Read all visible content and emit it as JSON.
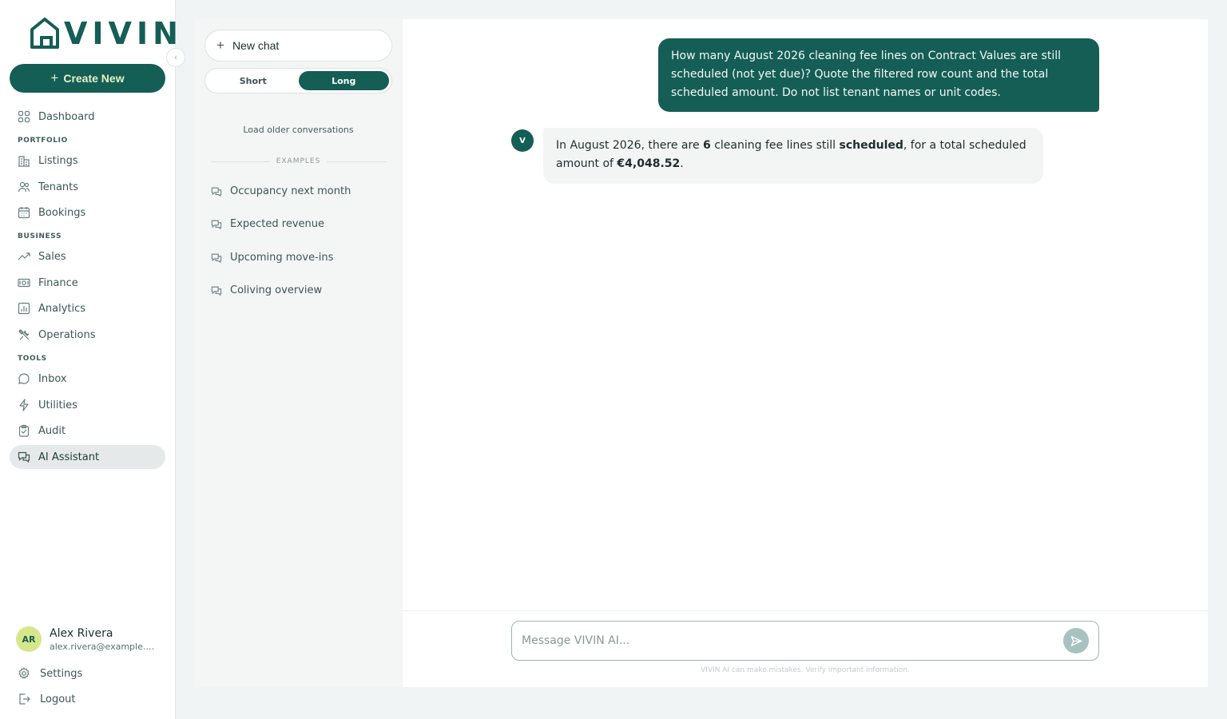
{
  "brand": {
    "name": "VIVIN"
  },
  "sidebar": {
    "create_label": "Create New",
    "dashboard": "Dashboard",
    "sections": {
      "portfolio": "PORTFOLIO",
      "business": "BUSINESS",
      "tools": "TOOLS"
    },
    "portfolio": [
      "Listings",
      "Tenants",
      "Bookings"
    ],
    "business": [
      "Sales",
      "Finance",
      "Analytics",
      "Operations"
    ],
    "tools": [
      "Inbox",
      "Utilities",
      "Audit",
      "AI Assistant"
    ],
    "active_item": "AI Assistant"
  },
  "user": {
    "initials": "AR",
    "name": "Alex Rivera",
    "email": "alex.rivera@example.com"
  },
  "footer": {
    "settings": "Settings",
    "logout": "Logout"
  },
  "conversations": {
    "new_chat": "New chat",
    "toggle": {
      "short": "Short",
      "long": "Long",
      "selected": "Long"
    },
    "load_older": "Load older conversations",
    "examples_label": "EXAMPLES",
    "examples": [
      "Occupancy next month",
      "Expected revenue",
      "Upcoming move-ins",
      "Coliving overview"
    ]
  },
  "chat": {
    "user_message": "How many August 2026 cleaning fee lines on Contract Values are still scheduled (not yet due)? Quote the filtered row count and the total scheduled amount. Do not list tenant names or unit codes.",
    "bot_avatar": "V",
    "bot_message": {
      "part1": "In August 2026, there are ",
      "count": "6",
      "part2": " cleaning fee lines still ",
      "status": "scheduled",
      "part3": ", for a total scheduled amount of ",
      "amount": "€4,048.52",
      "part4": "."
    },
    "placeholder": "Message VIVIN AI...",
    "disclaimer": "VIVIN AI can make mistakes. Verify important information."
  },
  "colors": {
    "brand": "#155e56",
    "accent": "#d7e68b",
    "active_bg": "#e5e9e9"
  }
}
